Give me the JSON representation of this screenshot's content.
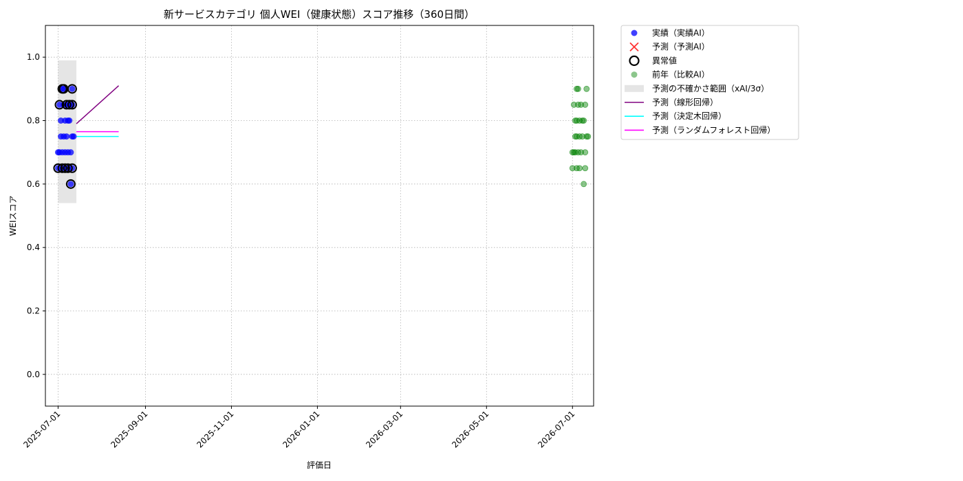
{
  "chart_data": {
    "type": "scatter",
    "title": "新サービスカテゴリ 個人WEI（健康状態）スコア推移（360日間）",
    "xlabel": "評価日",
    "ylabel": "WEIスコア",
    "xlim": [
      "2025-06-22",
      "2026-07-16"
    ],
    "ylim": [
      -0.1,
      1.1
    ],
    "yticks": [
      0.0,
      0.2,
      0.4,
      0.6,
      0.8,
      1.0
    ],
    "xticks": [
      "2025-07-01",
      "2025-09-01",
      "2025-11-01",
      "2026-01-01",
      "2026-03-01",
      "2026-05-01",
      "2026-07-01"
    ],
    "grid": true,
    "legend_position": "outside-upper-right",
    "colors": {
      "actual": "#0000ff",
      "forecast": "#ff0000",
      "anomaly": "#000000",
      "last_year": "#008000",
      "band": "#d3d3d3",
      "linear": "#800080",
      "tree": "#00ffff",
      "forest": "#ff00ff"
    },
    "legend": [
      {
        "key": "actual",
        "label": "実績（実績AI）",
        "marker": "dot"
      },
      {
        "key": "forecast",
        "label": "予測（予測AI）",
        "marker": "x"
      },
      {
        "key": "anomaly",
        "label": "異常値",
        "marker": "ring"
      },
      {
        "key": "last_year",
        "label": "前年（比較AI）",
        "marker": "dot"
      },
      {
        "key": "band",
        "label": "予測の不確かさ範囲（xAI/3σ）",
        "marker": "rect"
      },
      {
        "key": "linear",
        "label": "予測（線形回帰）",
        "marker": "line"
      },
      {
        "key": "tree",
        "label": "予測（決定木回帰）",
        "marker": "line"
      },
      {
        "key": "forest",
        "label": "予測（ランダムフォレスト回帰）",
        "marker": "line"
      }
    ],
    "actual": [
      {
        "x": "2025-07-01",
        "y": 0.65
      },
      {
        "x": "2025-07-01",
        "y": 0.7
      },
      {
        "x": "2025-07-02",
        "y": 0.85
      },
      {
        "x": "2025-07-02",
        "y": 0.7
      },
      {
        "x": "2025-07-03",
        "y": 0.75
      },
      {
        "x": "2025-07-03",
        "y": 0.8
      },
      {
        "x": "2025-07-04",
        "y": 0.65
      },
      {
        "x": "2025-07-04",
        "y": 0.9
      },
      {
        "x": "2025-07-04",
        "y": 0.7
      },
      {
        "x": "2025-07-05",
        "y": 0.85
      },
      {
        "x": "2025-07-05",
        "y": 0.75
      },
      {
        "x": "2025-07-05",
        "y": 0.9
      },
      {
        "x": "2025-07-06",
        "y": 0.8
      },
      {
        "x": "2025-07-06",
        "y": 0.65
      },
      {
        "x": "2025-07-06",
        "y": 0.7
      },
      {
        "x": "2025-07-07",
        "y": 0.85
      },
      {
        "x": "2025-07-07",
        "y": 0.75
      },
      {
        "x": "2025-07-08",
        "y": 0.8
      },
      {
        "x": "2025-07-08",
        "y": 0.7
      },
      {
        "x": "2025-07-08",
        "y": 0.65
      },
      {
        "x": "2025-07-09",
        "y": 0.85
      },
      {
        "x": "2025-07-09",
        "y": 0.8
      },
      {
        "x": "2025-07-10",
        "y": 0.6
      },
      {
        "x": "2025-07-10",
        "y": 0.7
      },
      {
        "x": "2025-07-11",
        "y": 0.75
      },
      {
        "x": "2025-07-11",
        "y": 0.65
      },
      {
        "x": "2025-07-11",
        "y": 0.85
      },
      {
        "x": "2025-07-11",
        "y": 0.9
      },
      {
        "x": "2025-07-12",
        "y": 0.75
      }
    ],
    "anomalies": [
      {
        "x": "2025-07-01",
        "y": 0.65
      },
      {
        "x": "2025-07-02",
        "y": 0.85
      },
      {
        "x": "2025-07-04",
        "y": 0.65
      },
      {
        "x": "2025-07-04",
        "y": 0.9
      },
      {
        "x": "2025-07-05",
        "y": 0.9
      },
      {
        "x": "2025-07-06",
        "y": 0.65
      },
      {
        "x": "2025-07-07",
        "y": 0.85
      },
      {
        "x": "2025-07-08",
        "y": 0.65
      },
      {
        "x": "2025-07-09",
        "y": 0.85
      },
      {
        "x": "2025-07-10",
        "y": 0.6
      },
      {
        "x": "2025-07-11",
        "y": 0.65
      },
      {
        "x": "2025-07-11",
        "y": 0.85
      },
      {
        "x": "2025-07-11",
        "y": 0.9
      }
    ],
    "last_year": [
      {
        "x": "2026-07-01",
        "y": 0.7
      },
      {
        "x": "2026-07-01",
        "y": 0.65
      },
      {
        "x": "2026-07-02",
        "y": 0.85
      },
      {
        "x": "2026-07-02",
        "y": 0.7
      },
      {
        "x": "2026-07-03",
        "y": 0.8
      },
      {
        "x": "2026-07-03",
        "y": 0.75
      },
      {
        "x": "2026-07-03",
        "y": 0.7
      },
      {
        "x": "2026-07-04",
        "y": 0.9
      },
      {
        "x": "2026-07-04",
        "y": 0.8
      },
      {
        "x": "2026-07-04",
        "y": 0.75
      },
      {
        "x": "2026-07-04",
        "y": 0.65
      },
      {
        "x": "2026-07-05",
        "y": 0.85
      },
      {
        "x": "2026-07-05",
        "y": 0.9
      },
      {
        "x": "2026-07-05",
        "y": 0.7
      },
      {
        "x": "2026-07-06",
        "y": 0.75
      },
      {
        "x": "2026-07-06",
        "y": 0.8
      },
      {
        "x": "2026-07-06",
        "y": 0.65
      },
      {
        "x": "2026-07-07",
        "y": 0.85
      },
      {
        "x": "2026-07-07",
        "y": 0.7
      },
      {
        "x": "2026-07-08",
        "y": 0.8
      },
      {
        "x": "2026-07-08",
        "y": 0.75
      },
      {
        "x": "2026-07-09",
        "y": 0.6
      },
      {
        "x": "2026-07-09",
        "y": 0.8
      },
      {
        "x": "2026-07-10",
        "y": 0.85
      },
      {
        "x": "2026-07-10",
        "y": 0.7
      },
      {
        "x": "2026-07-10",
        "y": 0.65
      },
      {
        "x": "2026-07-11",
        "y": 0.9
      },
      {
        "x": "2026-07-11",
        "y": 0.75
      },
      {
        "x": "2026-07-12",
        "y": 0.75
      }
    ],
    "band": {
      "x_start": "2025-07-01",
      "x_end": "2025-07-14",
      "y_low": 0.54,
      "y_high": 0.99
    },
    "linear": [
      {
        "x": "2025-07-14",
        "y": 0.79
      },
      {
        "x": "2025-08-13",
        "y": 0.91
      }
    ],
    "tree": [
      {
        "x": "2025-07-14",
        "y": 0.75
      },
      {
        "x": "2025-08-13",
        "y": 0.75
      }
    ],
    "forest": [
      {
        "x": "2025-07-14",
        "y": 0.765
      },
      {
        "x": "2025-08-13",
        "y": 0.765
      }
    ]
  }
}
